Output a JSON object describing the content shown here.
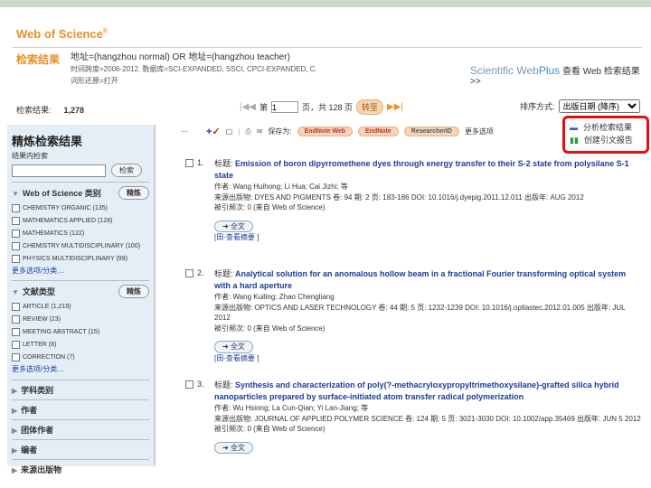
{
  "header": {
    "logo": "Web of Science",
    "logo_mark": "®",
    "results_title": "检索结果",
    "query": "地址=(hangzhou normal) OR 地址=(hangzhou teacher)",
    "query_line2": "时间跨度=2006-2012. 数据库=SCI-EXPANDED, SSCI, CPCI-EXPANDED, C.",
    "query_line3": "词形还原=打开",
    "webplus_a": "Scientific Web",
    "webplus_b": "Plus",
    "webplus_link": "查看 Web 检索结果 >>"
  },
  "pager": {
    "count_label": "检索结果:",
    "count": "1,278",
    "page_prefix": "第",
    "page": "1",
    "page_suffix": "页，共 128 页",
    "go": "转至",
    "sort_label": "排序方式:",
    "sort_value": "出版日期 (降序)"
  },
  "toolbar": {
    "save_label": "保存为:",
    "endnote_web": "EndNote Web",
    "endnote": "EndNote",
    "researcherid": "ResearcherID",
    "more": "更多选项",
    "analyze": "分析检索结果",
    "citation": "创建引文报告"
  },
  "sidebar": {
    "title": "精炼检索结果",
    "search_within": "结果内检索",
    "search_btn": "检索",
    "refine": "精炼",
    "wos_cat": "Web of Science 类别",
    "categories": [
      "CHEMISTRY ORGANIC (135)",
      "MATHEMATICS APPLIED (128)",
      "MATHEMATICS (122)",
      "CHEMISTRY MULTIDISCIPLINARY (100)",
      "PHYSICS MULTIDISCIPLINARY (99)"
    ],
    "more": "更多选项/分类…",
    "doc_type": "文献类型",
    "doc_types": [
      "ARTICLE (1,219)",
      "REVIEW (23)",
      "MEETING ABSTRACT (15)",
      "LETTER (8)",
      "CORRECTION (7)"
    ],
    "collapsed": [
      "学科类别",
      "作者",
      "团体作者",
      "编者",
      "来源出版物"
    ]
  },
  "records": [
    {
      "num": "1.",
      "title_label": "标题:",
      "title": "Emission of boron dipyrromethene dyes through energy transfer to their S-2 state from polysilane S-1 state",
      "authors": "作者: Wang Huihong; Li Hua; Cai Jizhi; 等",
      "source": "来源出版物: DYES AND PIGMENTS 卷: 94 期: 2 页: 183-186 DOI: 10.1016/j.dyepig.2011.12.011 出版年: AUG 2012",
      "cited": "被引频次: 0 (来自 Web of Science)",
      "fulltext": "全文",
      "abstract": "[田-查看摘要 ]"
    },
    {
      "num": "2.",
      "title_label": "标题:",
      "title": "Analytical solution for an anomalous hollow beam in a fractional Fourier transforming optical system with a hard aperture",
      "authors": "作者: Wang Kuiling; Zhao Chengliang",
      "source": "来源出版物: OPTICS AND LASER TECHNOLOGY 卷: 44 期: 5 页: 1232-1239 DOI: 10.1016/j.optlastec.2012.01.005 出版年: JUL 2012",
      "cited": "被引频次: 0 (来自 Web of Science)",
      "fulltext": "全文",
      "abstract": "[田-查看摘要 ]"
    },
    {
      "num": "3.",
      "title_label": "标题:",
      "title": "Synthesis and characterization of poly(?-methacryloxypropyltrimethoxysilane)-grafted silica hybrid nanoparticles prepared by surface-initiated atom transfer radical polymerization",
      "authors": "作者: Wu Hsiong; La Cun-Qian; Yi Lan-Jiang; 等",
      "source": "来源出版物: JOURNAL OF APPLIED POLYMER SCIENCE 卷: 124 期: 5 页: 3021-3030 DOI: 10.1002/app.35469 出版年: JUN 5 2012",
      "cited": "被引频次: 0 (来自 Web of Science)",
      "fulltext": "全文"
    }
  ]
}
